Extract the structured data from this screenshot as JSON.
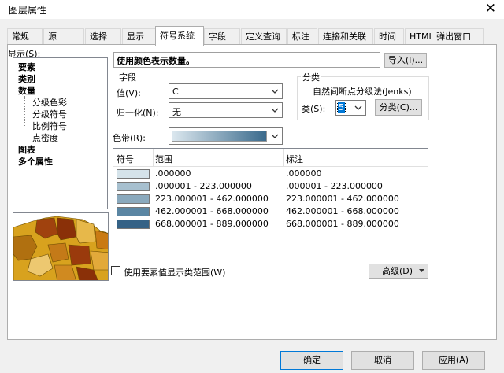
{
  "window": {
    "title": "图层属性",
    "close_glyph": "✕"
  },
  "tabs": [
    "常规",
    "源",
    "选择",
    "显示",
    "符号系统",
    "字段",
    "定义查询",
    "标注",
    "连接和关联",
    "时间",
    "HTML 弹出窗口"
  ],
  "active_tab": "符号系统",
  "show": {
    "label": "显示(S):",
    "items": [
      {
        "label": "要素"
      },
      {
        "label": "类别"
      },
      {
        "label": "数量"
      },
      {
        "label": "分级色彩"
      },
      {
        "label": "分级符号"
      },
      {
        "label": "比例符号"
      },
      {
        "label": "点密度"
      },
      {
        "label": "图表"
      },
      {
        "label": "多个属性"
      }
    ]
  },
  "description": "使用颜色表示数量。",
  "import_button": "导入(I)...",
  "fields": {
    "group_label": "字段",
    "value_label": "值(V):",
    "value": "C",
    "normalize_label": "归一化(N):",
    "normalize": "无"
  },
  "classification": {
    "group_label": "分类",
    "method": "自然间断点分级法(Jenks)",
    "classes_label": "类(S):",
    "classes": "5",
    "classify_button": "分类(C)..."
  },
  "color_ramp": {
    "label": "色带(R):",
    "start": "#dbe7ee",
    "end": "#3a6a8c"
  },
  "table": {
    "headers": [
      "符号",
      "范围",
      "标注"
    ],
    "rows": [
      {
        "color": "#d5e3ea",
        "range": ".000000",
        "label": ".000000"
      },
      {
        "color": "#a7c0cf",
        "range": ".000001 - 223.000000",
        "label": ".000001 - 223.000000"
      },
      {
        "color": "#8aa9bd",
        "range": "223.000001 - 462.000000",
        "label": "223.000001 - 462.000000"
      },
      {
        "color": "#5b86a3",
        "range": "462.000001 - 668.000000",
        "label": "462.000001 - 668.000000"
      },
      {
        "color": "#356286",
        "range": "668.000001 - 889.000000",
        "label": "668.000001 - 889.000000"
      }
    ]
  },
  "show_class_ranges": "使用要素值显示类范围(W)",
  "advanced_button": "高级(D)",
  "footer": {
    "ok": "确定",
    "cancel": "取消",
    "apply": "应用(A)"
  }
}
